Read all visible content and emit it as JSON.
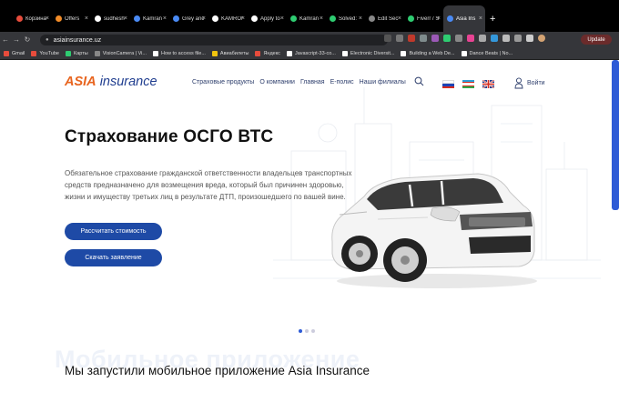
{
  "browser": {
    "tabs": [
      {
        "label": "Корзина",
        "color": "#e74c3c"
      },
      {
        "label": "Offers",
        "color": "#f28c28"
      },
      {
        "label": "sudhesh",
        "color": "#ffffff"
      },
      {
        "label": "Kamran",
        "color": "#4a8af4"
      },
      {
        "label": "Grey and",
        "color": "#4a8af4"
      },
      {
        "label": "KAMRON",
        "color": "#ffffff"
      },
      {
        "label": "Apply to",
        "color": "#ffffff"
      },
      {
        "label": "Kamran",
        "color": "#2ecc71"
      },
      {
        "label": "Solved:",
        "color": "#2ecc71"
      },
      {
        "label": "Edit Sec",
        "color": "#888888"
      },
      {
        "label": "Fiverr / S",
        "color": "#2ecc71"
      },
      {
        "label": "Asia Ins",
        "color": "#4a8af4",
        "active": true
      }
    ],
    "new_tab": "+",
    "url": "asiainsurance.uz",
    "update_label": "Update",
    "bookmarks": [
      {
        "label": "Gmail",
        "color": "#e74c3c"
      },
      {
        "label": "YouTube",
        "color": "#e74c3c"
      },
      {
        "label": "Карты",
        "color": "#2ecc71"
      },
      {
        "label": "VisionCamera | Vi...",
        "color": "#888888"
      },
      {
        "label": "How to access file...",
        "color": "#ffffff"
      },
      {
        "label": "Авиабилеты",
        "color": "#f1c40f"
      },
      {
        "label": "Яндекс",
        "color": "#e74c3c"
      },
      {
        "label": "Javascript-33-co...",
        "color": "#ffffff"
      },
      {
        "label": "Electronic Diversit...",
        "color": "#ffffff"
      },
      {
        "label": "Building a Web De...",
        "color": "#ffffff"
      },
      {
        "label": "Dance Beats | No...",
        "color": "#ffffff"
      }
    ]
  },
  "site": {
    "logo_asia": "ASIA",
    "logo_insurance": "insurance",
    "menu": [
      "Страховые продукты",
      "О компании",
      "Главная",
      "Е-полис",
      "Наши филиалы"
    ],
    "login": "Войти",
    "hero_title": "Страхование ОСГО ВТС",
    "hero_text": "Обязательное страхование гражданской ответственности владельцев транспортных средств  предназначено для возмещения вреда, который был причинен здоровью, жизни и имуществу третьих лиц в результате ДТП, произошедшего по вашей вине.",
    "button_calc": "Рассчитать стоимость",
    "button_apply": "Скачать заявление",
    "ghost_text": "Мобильное приложение",
    "mobile_title": "Мы запустили мобильное приложение Asia Insurance"
  }
}
